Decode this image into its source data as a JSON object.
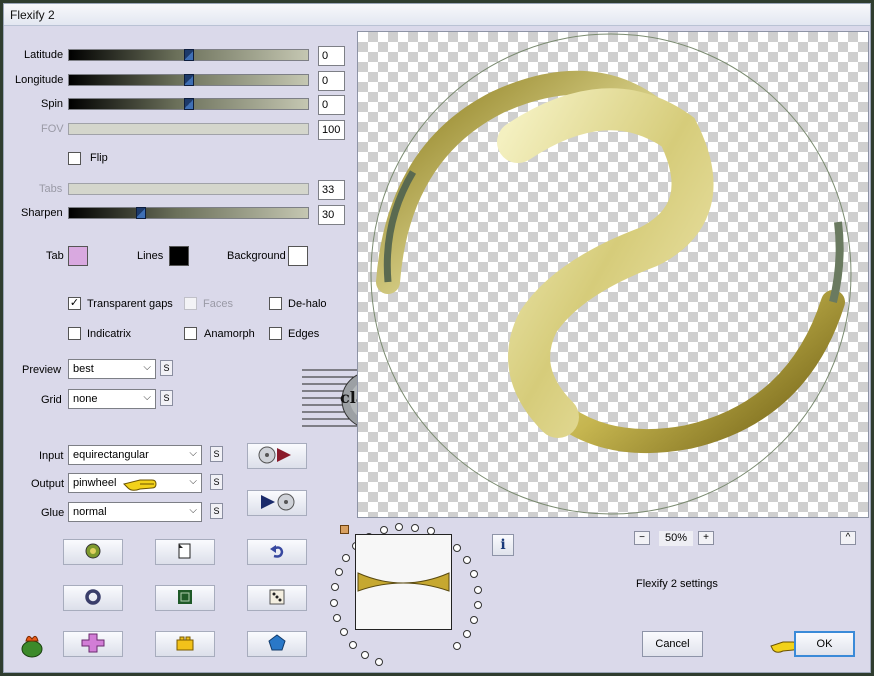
{
  "window": {
    "title": "Flexify 2"
  },
  "sliders": [
    {
      "label": "Latitude",
      "value": "0",
      "level": 0.5,
      "disabled": false
    },
    {
      "label": "Longitude",
      "value": "0",
      "level": 0.5,
      "disabled": false
    },
    {
      "label": "Spin",
      "value": "0",
      "level": 0.5,
      "disabled": false
    },
    {
      "label": "FOV",
      "value": "100",
      "disabled": true
    },
    {
      "label": "Tabs",
      "value": "33",
      "disabled": true
    },
    {
      "label": "Sharpen",
      "value": "30",
      "level": 0.3,
      "disabled": false
    }
  ],
  "flip": {
    "label": "Flip",
    "checked": false
  },
  "colors": {
    "tab_label": "Tab",
    "tab_color": "#d9a9e0",
    "lines_label": "Lines",
    "lines_color": "#000000",
    "background_label": "Background",
    "background_color": "#ffffff"
  },
  "options": {
    "transparent_gaps": {
      "label": "Transparent gaps",
      "checked": true
    },
    "faces": {
      "label": "Faces",
      "checked": false,
      "disabled": true
    },
    "de_halo": {
      "label": "De-halo",
      "checked": false
    },
    "indicatrix": {
      "label": "Indicatrix",
      "checked": false
    },
    "anamorph": {
      "label": "Anamorph",
      "checked": false
    },
    "edges": {
      "label": "Edges",
      "checked": false
    }
  },
  "preview_select": {
    "label": "Preview",
    "value": "best"
  },
  "grid_select": {
    "label": "Grid",
    "value": "none"
  },
  "input_select": {
    "label": "Input",
    "value": "equirectangular"
  },
  "output_select": {
    "label": "Output",
    "value": "pinwheel"
  },
  "glue_select": {
    "label": "Glue",
    "value": "normal"
  },
  "s_label": "S",
  "zoom": {
    "value": "50%",
    "minus": "−",
    "plus": "+"
  },
  "settings_text": "Flexify 2 settings",
  "info_glyph": "i",
  "collapse_glyph": "^",
  "buttons": {
    "cancel": "Cancel",
    "ok": "OK"
  },
  "watermark": "claudia",
  "icons": [
    "disc-to-play-icon",
    "play-to-disc-icon",
    "globe-icon",
    "page-icon",
    "undo-arrow-icon",
    "ring-icon",
    "square-icon",
    "dice-icon",
    "plus-shape-icon",
    "lego-brick-icon",
    "pentagon-icon",
    "hand-pointer-icon",
    "flower-logo-icon"
  ]
}
